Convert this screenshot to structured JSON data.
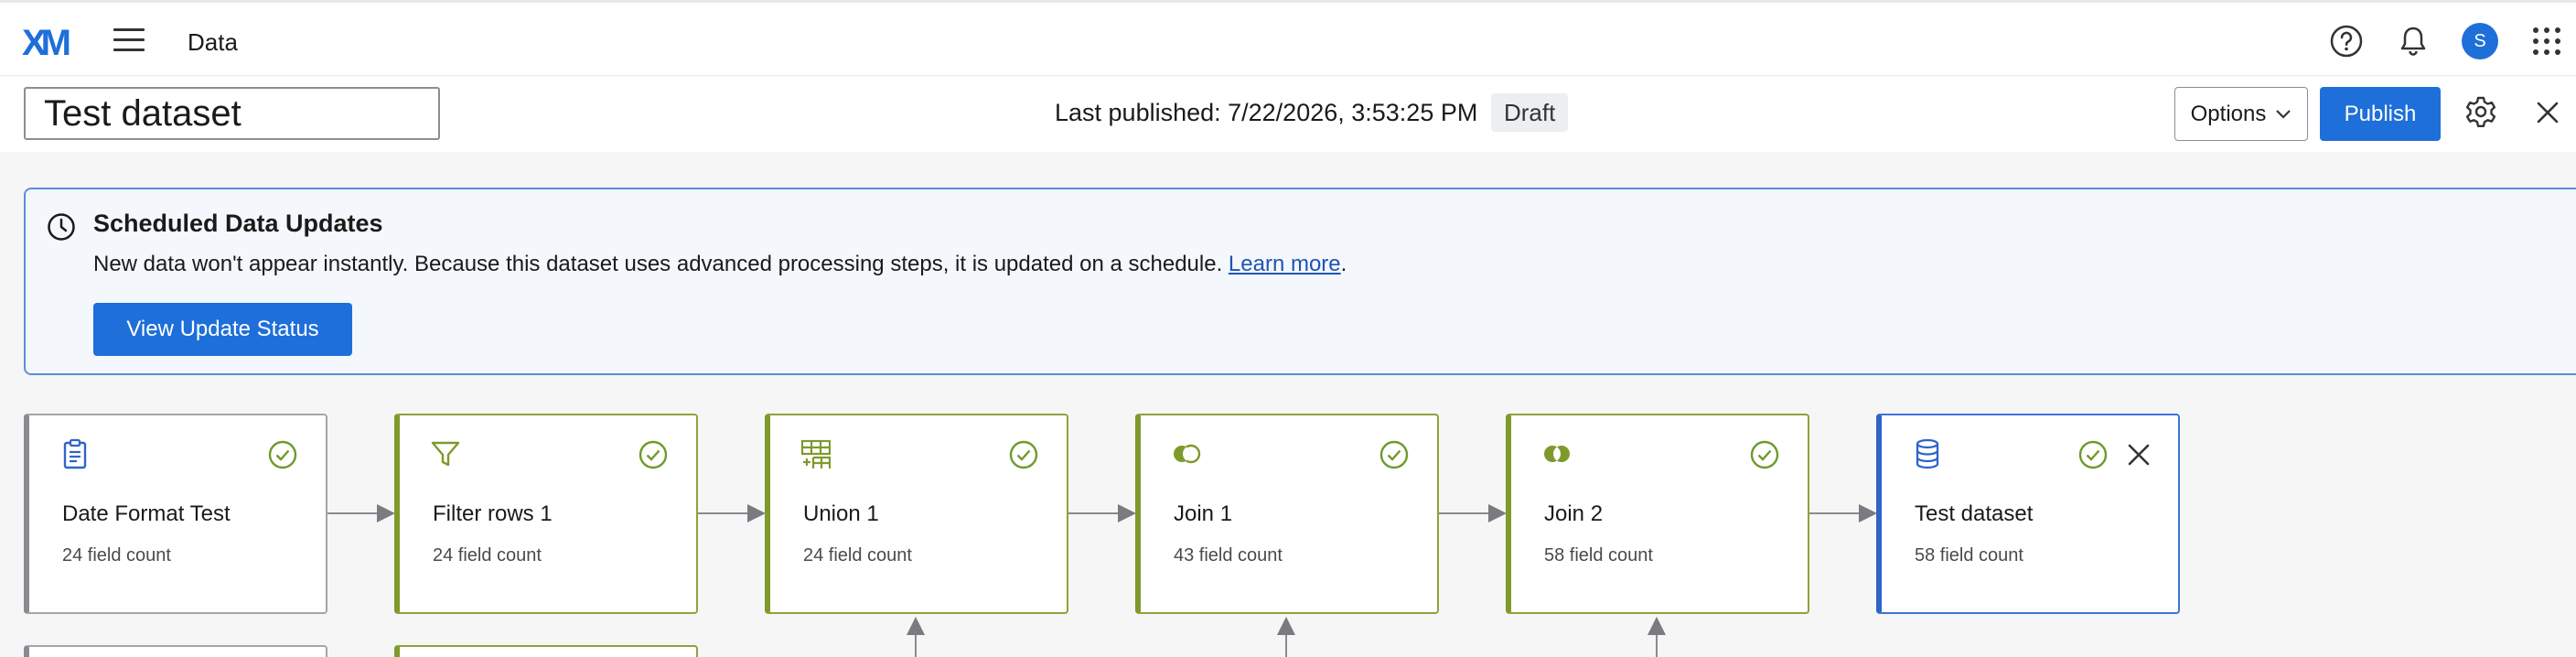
{
  "app": {
    "logo": "XM",
    "title": "Data",
    "avatar_initial": "S"
  },
  "header": {
    "dataset_name": "Test dataset",
    "last_published": "Last published: 7/22/2026, 3:53:25 PM",
    "status_badge": "Draft",
    "options_label": "Options",
    "publish_label": "Publish"
  },
  "banner": {
    "title": "Scheduled Data Updates",
    "text": "New data won't appear instantly. Because this dataset uses advanced processing steps, it is updated on a schedule.",
    "link": "Learn more",
    "period": ".",
    "button": "View Update Status"
  },
  "nodes": [
    {
      "name": "Date Format Test",
      "count": "24 field count",
      "kind": "source",
      "icon": "document-icon"
    },
    {
      "name": "Filter rows 1",
      "count": "24 field count",
      "kind": "transform",
      "icon": "filter-icon"
    },
    {
      "name": "Union 1",
      "count": "24 field count",
      "kind": "transform",
      "icon": "union-table-icon"
    },
    {
      "name": "Join 1",
      "count": "43 field count",
      "kind": "transform",
      "icon": "join-icon"
    },
    {
      "name": "Join 2",
      "count": "58 field count",
      "kind": "transform",
      "icon": "join-icon"
    },
    {
      "name": "Test dataset",
      "count": "58 field count",
      "kind": "output",
      "icon": "database-icon"
    }
  ],
  "colors": {
    "accent": "#1e6fd9",
    "transform_border": "#8da33a",
    "output_border": "#3f74d4",
    "source_border": "#a5a5ab",
    "success_check": "#6f9a2c"
  }
}
